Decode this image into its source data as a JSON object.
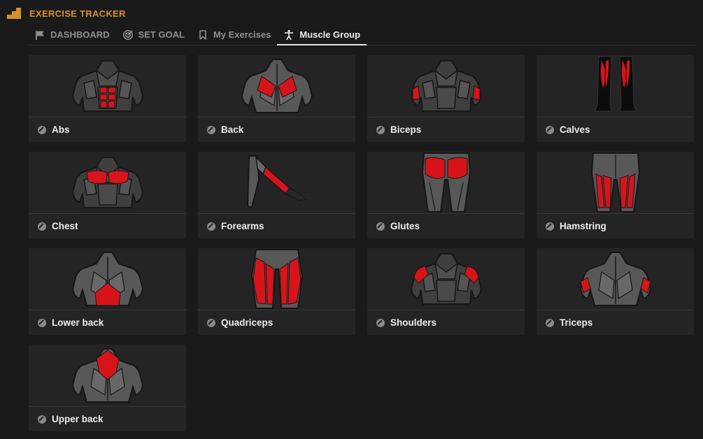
{
  "app": {
    "title": "EXERCISE TRACKER",
    "logo_icon": "stairs-logo-icon",
    "accent_color": "#d9902b"
  },
  "tabs": [
    {
      "label": "DASHBOARD",
      "icon": "flag-icon",
      "active": false
    },
    {
      "label": "SET GOAL",
      "icon": "target-icon",
      "active": false
    },
    {
      "label": "My Exercises",
      "icon": "bookmark-icon",
      "active": false
    },
    {
      "label": "Muscle Group",
      "icon": "person-icon",
      "active": true
    }
  ],
  "muscle_groups": [
    {
      "label": "Abs",
      "icon": "dumbbell-icon",
      "highlight_color": "#d7141a"
    },
    {
      "label": "Back",
      "icon": "dumbbell-icon",
      "highlight_color": "#d7141a"
    },
    {
      "label": "Biceps",
      "icon": "dumbbell-icon",
      "highlight_color": "#d7141a"
    },
    {
      "label": "Calves",
      "icon": "dumbbell-icon",
      "highlight_color": "#d7141a"
    },
    {
      "label": "Chest",
      "icon": "dumbbell-icon",
      "highlight_color": "#d7141a"
    },
    {
      "label": "Forearms",
      "icon": "dumbbell-icon",
      "highlight_color": "#d7141a"
    },
    {
      "label": "Glutes",
      "icon": "dumbbell-icon",
      "highlight_color": "#d7141a"
    },
    {
      "label": "Hamstring",
      "icon": "dumbbell-icon",
      "highlight_color": "#d7141a"
    },
    {
      "label": "Lower back",
      "icon": "dumbbell-icon",
      "highlight_color": "#d7141a"
    },
    {
      "label": "Quadriceps",
      "icon": "dumbbell-icon",
      "highlight_color": "#d7141a"
    },
    {
      "label": "Shoulders",
      "icon": "dumbbell-icon",
      "highlight_color": "#d7141a"
    },
    {
      "label": "Triceps",
      "icon": "dumbbell-icon",
      "highlight_color": "#d7141a"
    },
    {
      "label": "Upper back",
      "icon": "dumbbell-icon",
      "highlight_color": "#d7141a"
    }
  ]
}
